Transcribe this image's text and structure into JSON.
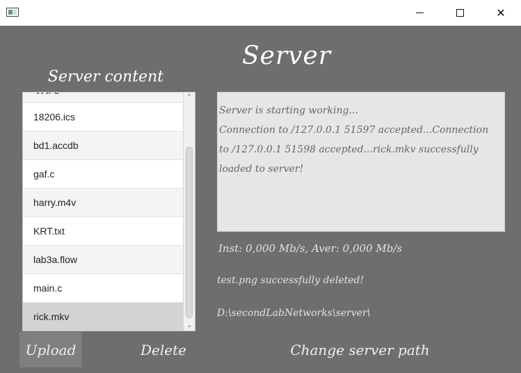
{
  "titlebar": {
    "icons": {
      "app": "app-icon",
      "minimize": "minimize-icon",
      "maximize": "maximize-icon",
      "close": "close-icon"
    },
    "close_glyph": "✕"
  },
  "header": {
    "title": "Server"
  },
  "file_panel": {
    "label": "Server content",
    "partial_top_item": "ryj.jpg",
    "items": [
      "18206.ics",
      "bd1.accdb",
      "gaf.c",
      "harry.m4v",
      "KRT.txt",
      "lab3a.flow",
      "main.c",
      "rick.mkv"
    ],
    "selected_item": "rick.mkv",
    "scroll_up_glyph": "⌃",
    "scroll_down_glyph": "⌄"
  },
  "log": {
    "text": "Server is starting working...\nConnection to /127.0.0.1 51597 accepted...Connection to /127.0.0.1 51598 accepted...rick.mkv successfully loaded to server!"
  },
  "speed": "Inst: 0,000 Mb/s, Aver: 0,000 Mb/s",
  "status": "test.png successfully deleted!",
  "path": "D:\\secondLabNetworks\\server\\",
  "buttons": {
    "upload": "Upload",
    "delete": "Delete",
    "change_path": "Change server path"
  },
  "colors": {
    "background": "#6e6e6e",
    "selected_row": "#d3d3d3",
    "log_background": "#e6e6e6"
  }
}
